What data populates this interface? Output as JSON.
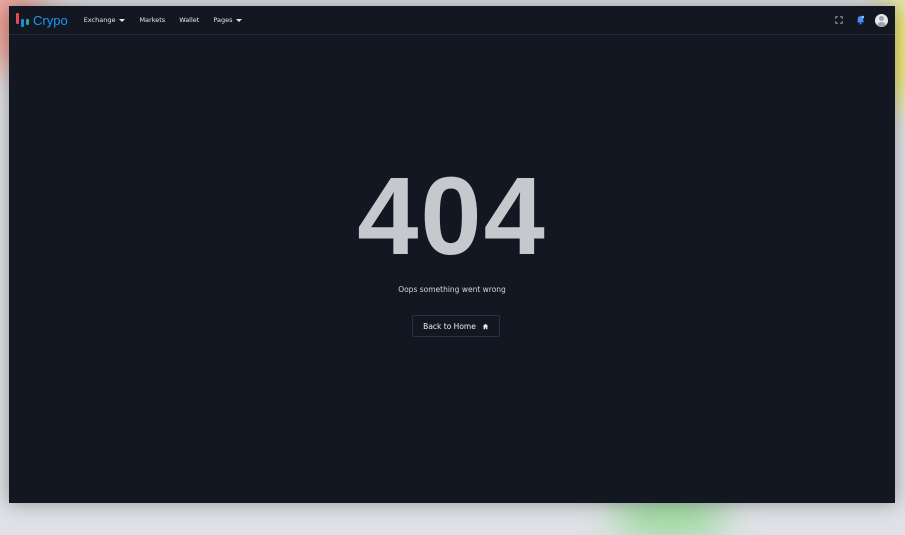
{
  "brand": {
    "name": "Crypo"
  },
  "nav": {
    "items": [
      {
        "label": "Exchange",
        "dropdown": true
      },
      {
        "label": "Markets",
        "dropdown": false
      },
      {
        "label": "Wallet",
        "dropdown": false
      },
      {
        "label": "Pages",
        "dropdown": true
      }
    ]
  },
  "header_icons": [
    "fullscreen-icon",
    "notification-bell-icon",
    "user-avatar"
  ],
  "error": {
    "code": "404",
    "message": "Oops something went wrong",
    "button_label": "Back to Home",
    "button_icon": "home-icon"
  },
  "colors": {
    "background": "#131722",
    "brand": "#2196f3",
    "code_text": "#c5c8cc",
    "bell": "#4a8ff7"
  }
}
